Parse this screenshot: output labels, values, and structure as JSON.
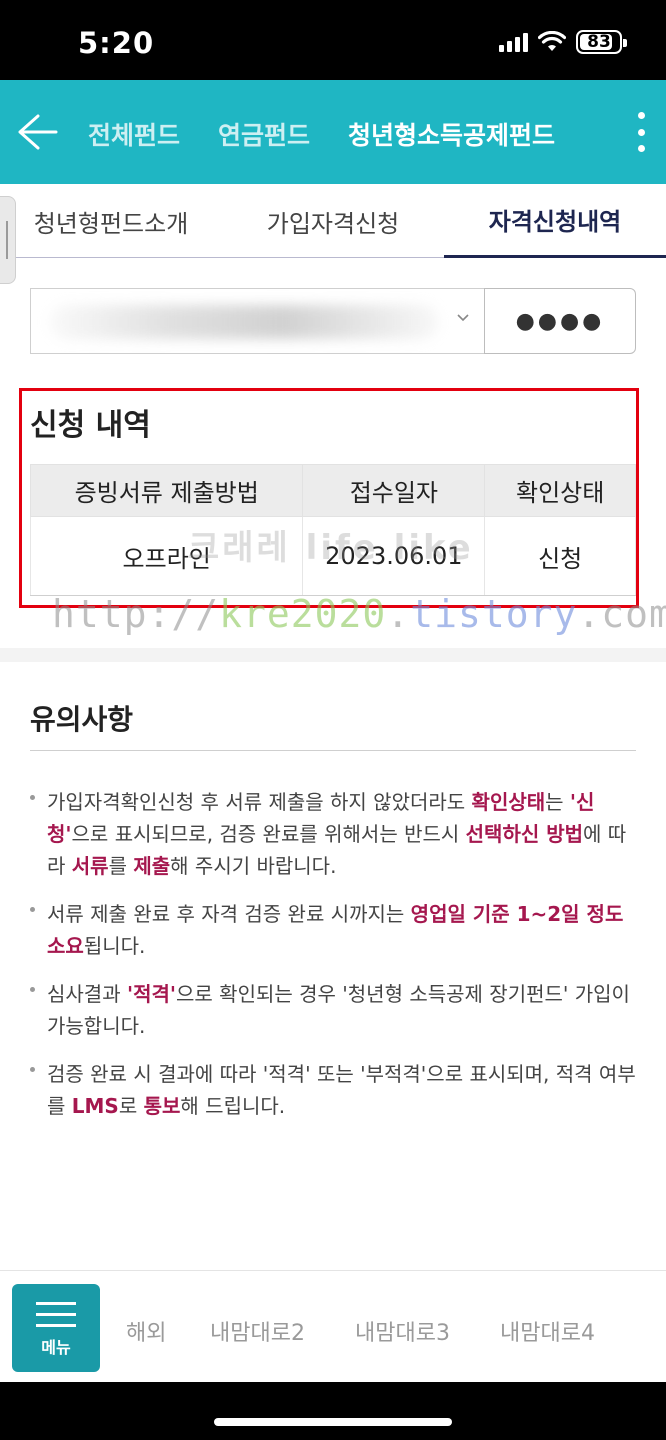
{
  "status_bar": {
    "time": "5:20",
    "battery": "83",
    "battery_level": 0.83
  },
  "header": {
    "tabs": [
      {
        "label": "전체펀드",
        "active": false
      },
      {
        "label": "연금펀드",
        "active": false
      },
      {
        "label": "청년형소득공제펀드",
        "active": true
      }
    ],
    "accent": "#1fb6c3"
  },
  "sub_tabs": [
    {
      "label": "청년형펀드소개",
      "active": false
    },
    {
      "label": "가입자격신청",
      "active": false
    },
    {
      "label": "자격신청내역",
      "active": true
    }
  ],
  "account_select": {
    "pin_mask": "●●●●"
  },
  "history": {
    "title": "신청 내역",
    "columns": [
      "증빙서류 제출방법",
      "접수일자",
      "확인상태"
    ],
    "rows": [
      {
        "method": "오프라인",
        "date": "2023.06.01",
        "status": "신청"
      }
    ]
  },
  "watermarks": {
    "line1": "크래레 life like",
    "line2": "http://kre2020.tistory.com"
  },
  "notes": {
    "title": "유의사항",
    "items": [
      [
        {
          "t": "가입자격확인신청 후 서류 제출을 하지 않았더라도 "
        },
        {
          "t": "확인상태",
          "hl": true
        },
        {
          "t": "는 "
        },
        {
          "t": "'신청'",
          "hl": true
        },
        {
          "t": "으로 표시되므로, 검증 완료를 위해서는 반드시 "
        },
        {
          "t": "선택하신 방법",
          "hl": true
        },
        {
          "t": "에 따라 "
        },
        {
          "t": "서류",
          "hl": true
        },
        {
          "t": "를 "
        },
        {
          "t": "제출",
          "hl": true
        },
        {
          "t": "해 주시기 바랍니다."
        }
      ],
      [
        {
          "t": "서류 제출 완료 후 자격 검증 완료 시까지는 "
        },
        {
          "t": "영업일 기준 1~2일 정도 소요",
          "hl": true
        },
        {
          "t": "됩니다."
        }
      ],
      [
        {
          "t": "심사결과 "
        },
        {
          "t": "'적격'",
          "hl": true
        },
        {
          "t": "으로 확인되는 경우 '청년형 소득공제 장기펀드' 가입이 가능합니다."
        }
      ],
      [
        {
          "t": "검증 완료 시 결과에 따라 '적격' 또는 '부적격'으로 표시되며, 적격 여부를 "
        },
        {
          "t": "LMS",
          "hl": true
        },
        {
          "t": "로 "
        },
        {
          "t": "통보",
          "hl": true
        },
        {
          "t": "해 드립니다."
        }
      ]
    ],
    "highlight_color": "#a5174e"
  },
  "bottom_nav": {
    "menu_label": "메뉴",
    "items": [
      "해외",
      "내맘대로2",
      "내맘대로3",
      "내맘대로4"
    ]
  }
}
